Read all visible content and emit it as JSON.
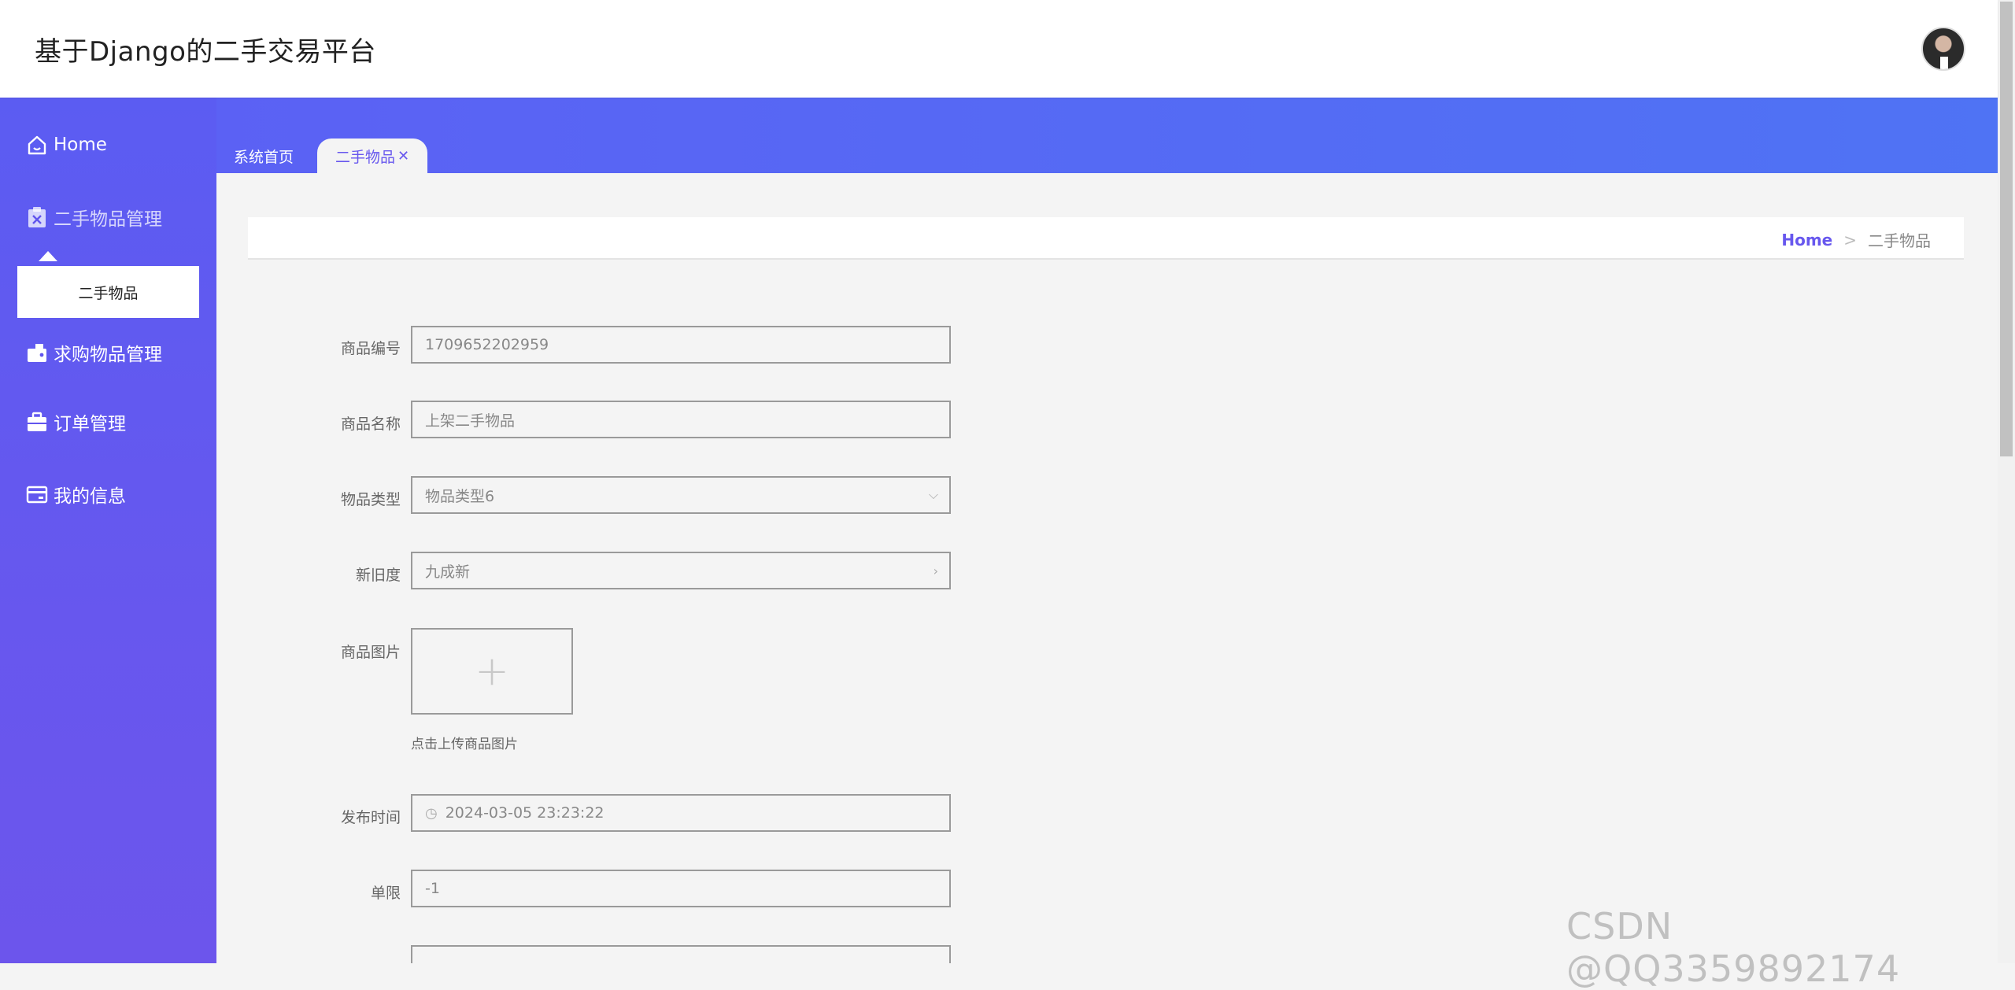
{
  "header": {
    "title": "基于Django的二手交易平台"
  },
  "sidebar": {
    "items": [
      {
        "label": "Home",
        "icon": "home-icon"
      },
      {
        "label": "二手物品管理",
        "icon": "clipboard-x-icon"
      },
      {
        "label": "求购物品管理",
        "icon": "wallet-icon"
      },
      {
        "label": "订单管理",
        "icon": "briefcase-icon"
      },
      {
        "label": "我的信息",
        "icon": "card-icon"
      }
    ],
    "submenu": {
      "label": "二手物品"
    }
  },
  "tabs": [
    {
      "label": "系统首页"
    },
    {
      "label": "二手物品",
      "close": "✕"
    }
  ],
  "breadcrumb": {
    "home": "Home",
    "sep": ">",
    "current": "二手物品"
  },
  "form": {
    "goods_no": {
      "label": "商品编号",
      "value": "1709652202959"
    },
    "goods_name": {
      "label": "商品名称",
      "value": "上架二手物品"
    },
    "type": {
      "label": "物品类型",
      "value": "物品类型6"
    },
    "condition": {
      "label": "新旧度",
      "value": "九成新"
    },
    "image": {
      "label": "商品图片",
      "hint": "点击上传商品图片"
    },
    "publish_time": {
      "label": "发布时间",
      "value": "2024-03-05 23:23:22"
    },
    "limit": {
      "label": "单限",
      "value": "-1"
    }
  },
  "watermark": "CSDN @QQ3359892174",
  "colors": {
    "sidebar": "#5b5cf2",
    "accent": "#6757ee",
    "banner": "#4f73f4"
  }
}
